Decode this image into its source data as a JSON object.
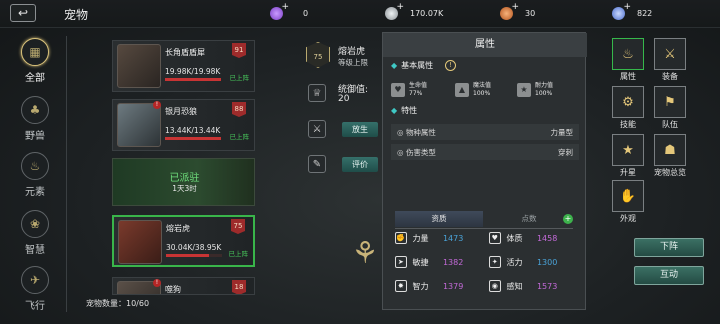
{
  "header": {
    "back_icon": "back-arrow-icon",
    "title": "宠物",
    "resources": [
      {
        "name": "purple-gem-icon",
        "value": "0",
        "color": "#9a5bd8"
      },
      {
        "name": "silver-coin-icon",
        "value": "170.07K",
        "color": "#b9bec2"
      },
      {
        "name": "copper-coin-icon",
        "value": "30",
        "color": "#d67b3a"
      },
      {
        "name": "blue-crystal-icon",
        "value": "822",
        "color": "#6d8fd8"
      }
    ],
    "plus": "+"
  },
  "categories": [
    {
      "label": "全部",
      "icon": "grid-icon",
      "active": true
    },
    {
      "label": "野兽",
      "icon": "beast-icon",
      "active": false
    },
    {
      "label": "元素",
      "icon": "element-icon",
      "active": false
    },
    {
      "label": "智慧",
      "icon": "wisdom-icon",
      "active": false
    },
    {
      "label": "飞行",
      "icon": "flying-icon",
      "active": false
    }
  ],
  "pets": [
    {
      "name": "长角盾盾犀",
      "hp": "19.98K/19.98K",
      "hp_ratio": 1.0,
      "level": "91",
      "tag": "已上阵",
      "alert": false
    },
    {
      "name": "银月恐狼",
      "hp": "13.44K/13.44K",
      "hp_ratio": 1.0,
      "level": "88",
      "tag": "已上阵",
      "alert": true
    },
    {
      "name": "熔岩虎",
      "hp": "30.04K/38.95K",
      "hp_ratio": 0.77,
      "level": "75",
      "tag": "已上阵",
      "alert": false
    },
    {
      "name": "噬狗",
      "hp": "",
      "hp_ratio": 0,
      "level": "18",
      "tag": "",
      "alert": true
    }
  ],
  "dispatched": {
    "title": "已派驻",
    "time": "1天3时"
  },
  "pet_count": {
    "label": "宠物数量：",
    "value": "10/60"
  },
  "detail": {
    "name": "熔岩虎",
    "level_badge": "75",
    "level_text": "等级上限",
    "command_label": "统御值:",
    "command_value": "20",
    "release_label": "放生",
    "review_label": "评价"
  },
  "popup": {
    "title": "属性",
    "basic_title": "基本属性",
    "stats": [
      {
        "name": "生命值",
        "value": "77%",
        "icon": "heart-icon"
      },
      {
        "name": "魔法值",
        "value": "100%",
        "icon": "mana-icon"
      },
      {
        "name": "耐力值",
        "value": "100%",
        "icon": "stamina-icon"
      }
    ],
    "traits_title": "特性",
    "traits": [
      {
        "label": "物种属性",
        "value": "力量型"
      },
      {
        "label": "伤害类型",
        "value": "穿刺"
      }
    ],
    "tabs": [
      "资质",
      "点数"
    ],
    "aptitudes": [
      {
        "name": "力量",
        "value": "1473",
        "color": "#4aa3d8"
      },
      {
        "name": "体质",
        "value": "1458",
        "color": "#c36ad8"
      },
      {
        "name": "敏捷",
        "value": "1382",
        "color": "#c36ad8"
      },
      {
        "name": "活力",
        "value": "1300",
        "color": "#4aa3d8"
      },
      {
        "name": "智力",
        "value": "1379",
        "color": "#c36ad8"
      },
      {
        "name": "感知",
        "value": "1573",
        "color": "#c36ad8"
      }
    ]
  },
  "right_menu": [
    {
      "label": "属性",
      "icon": "fire-icon",
      "active": true
    },
    {
      "label": "装备",
      "icon": "crossed-swords-icon",
      "active": false
    },
    {
      "label": "技能",
      "icon": "skill-icon",
      "active": false
    },
    {
      "label": "队伍",
      "icon": "flag-icon",
      "active": false
    },
    {
      "label": "升星",
      "icon": "star-icon",
      "active": false
    },
    {
      "label": "宠物总览",
      "icon": "overview-icon",
      "active": false
    },
    {
      "label": "外观",
      "icon": "appearance-icon",
      "active": false
    }
  ],
  "actions": {
    "unequip": "下阵",
    "interact": "互动"
  }
}
